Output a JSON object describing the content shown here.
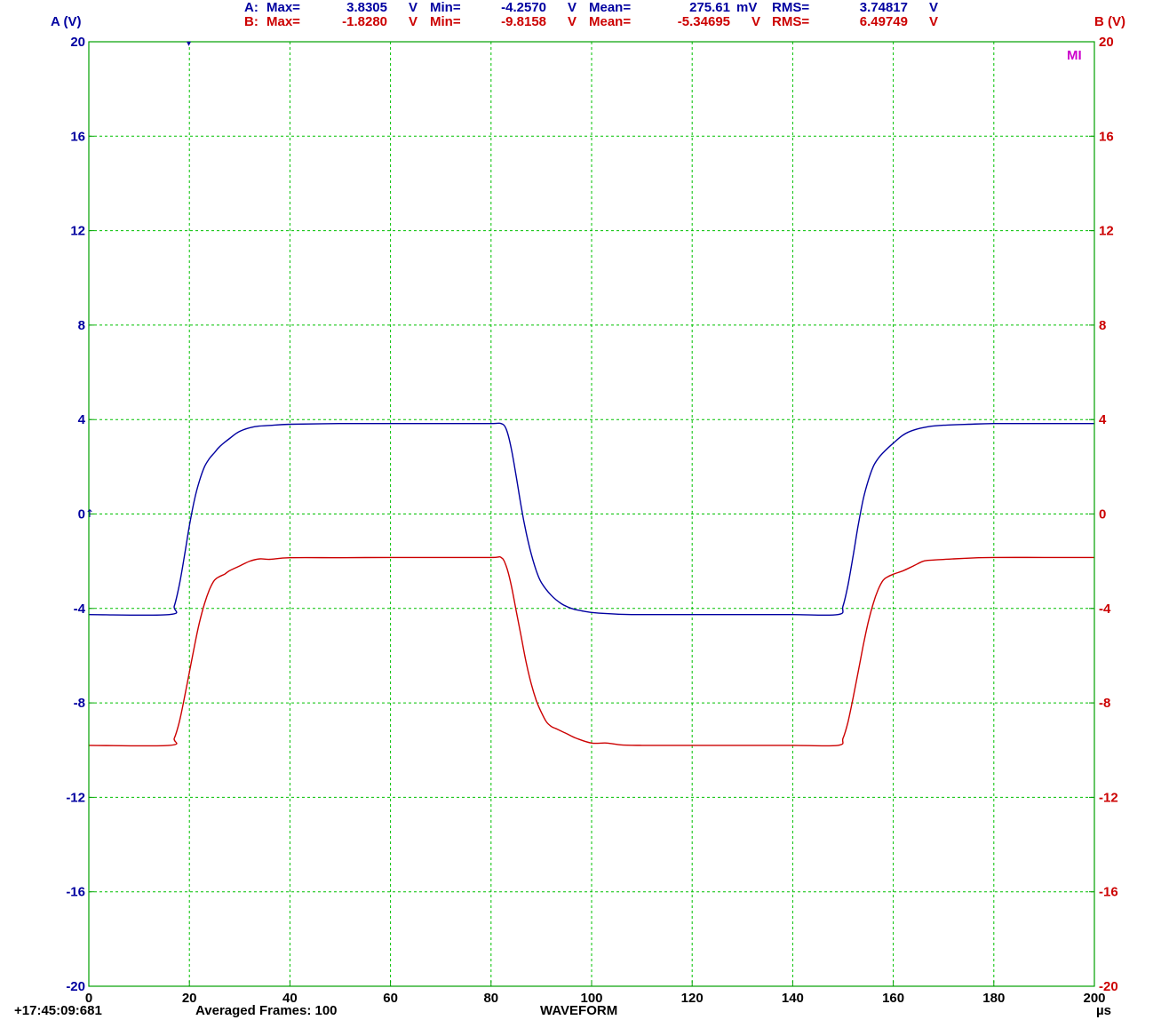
{
  "colors": {
    "channel_a": "#0000a0",
    "channel_b": "#cc0000",
    "grid": "#00c000",
    "frame": "#00a000",
    "math_label": "#cc00cc",
    "text": "#000000"
  },
  "stats": {
    "a": {
      "prefix": "A:",
      "max_label": "Max=",
      "max_value": "3.8305",
      "max_unit": "V",
      "min_label": "Min=",
      "min_value": "-4.2570",
      "min_unit": "V",
      "mean_label": "Mean=",
      "mean_value": "275.61",
      "mean_unit": "mV",
      "rms_label": "RMS=",
      "rms_value": "3.74817",
      "rms_unit": "V"
    },
    "b": {
      "prefix": "B:",
      "max_label": "Max=",
      "max_value": "-1.8280",
      "max_unit": "V",
      "min_label": "Min=",
      "min_value": "-9.8158",
      "min_unit": "V",
      "mean_label": "Mean=",
      "mean_value": "-5.34695",
      "mean_unit": "V",
      "rms_label": "RMS=",
      "rms_value": "6.49749",
      "rms_unit": "V"
    }
  },
  "footer": {
    "timestamp": "+17:45:09:681",
    "frames": "Averaged Frames: 100",
    "mode": "WAVEFORM",
    "x_unit": "µs"
  },
  "math_marker": "MI",
  "chart_data": {
    "type": "line",
    "y_left_label": "A (V)",
    "y_right_label": "B (V)",
    "xlim": [
      0,
      200
    ],
    "ylim": [
      -20,
      20
    ],
    "x_ticks": [
      "0",
      "20",
      "40",
      "60",
      "80",
      "100",
      "120",
      "140",
      "160",
      "180",
      "200"
    ],
    "y_ticks": [
      "20",
      "16",
      "12",
      "8",
      "4",
      "0",
      "-4",
      "-8",
      "-12",
      "-16",
      "-20"
    ],
    "grid": true,
    "series": [
      {
        "name": "A",
        "axis": "left",
        "x": [
          0,
          16,
          17,
          18,
          19,
          20,
          21,
          22,
          23,
          24,
          25,
          26,
          28,
          30,
          33,
          36,
          40,
          50,
          60,
          70,
          80,
          82,
          83,
          84,
          85,
          86,
          87,
          88,
          89,
          90,
          92,
          94,
          96,
          98,
          100,
          103,
          106,
          110,
          120,
          130,
          140,
          149,
          150,
          151,
          152,
          153,
          154,
          155,
          156,
          157,
          158,
          160,
          162,
          164,
          167,
          170,
          175,
          180,
          190,
          200
        ],
        "y": [
          -4.26,
          -4.26,
          -3.9,
          -3.0,
          -1.8,
          -0.5,
          0.6,
          1.4,
          2.0,
          2.35,
          2.6,
          2.85,
          3.2,
          3.5,
          3.7,
          3.75,
          3.8,
          3.83,
          3.83,
          3.83,
          3.83,
          3.83,
          3.6,
          2.8,
          1.6,
          0.3,
          -0.8,
          -1.7,
          -2.4,
          -2.9,
          -3.45,
          -3.8,
          -4.0,
          -4.1,
          -4.17,
          -4.22,
          -4.25,
          -4.26,
          -4.26,
          -4.26,
          -4.26,
          -4.26,
          -3.9,
          -3.0,
          -1.8,
          -0.5,
          0.6,
          1.4,
          2.0,
          2.35,
          2.6,
          3.0,
          3.35,
          3.55,
          3.7,
          3.76,
          3.8,
          3.83,
          3.83,
          3.83
        ]
      },
      {
        "name": "B",
        "axis": "right",
        "x": [
          0,
          16,
          17,
          18,
          19,
          20,
          21,
          22,
          23,
          24,
          25,
          26,
          27,
          28,
          30,
          32,
          34,
          36,
          40,
          50,
          60,
          70,
          80,
          82,
          83,
          84,
          85,
          86,
          87,
          88,
          89,
          90,
          91,
          92,
          93,
          95,
          97,
          100,
          103,
          106,
          110,
          120,
          130,
          140,
          149,
          150,
          151,
          152,
          153,
          154,
          155,
          156,
          157,
          158,
          159,
          160,
          162,
          164,
          166,
          168,
          172,
          176,
          180,
          190,
          200
        ],
        "y": [
          -9.8,
          -9.8,
          -9.5,
          -8.8,
          -7.8,
          -6.7,
          -5.6,
          -4.6,
          -3.8,
          -3.2,
          -2.8,
          -2.65,
          -2.55,
          -2.4,
          -2.2,
          -2.0,
          -1.9,
          -1.92,
          -1.85,
          -1.85,
          -1.84,
          -1.84,
          -1.84,
          -1.84,
          -2.2,
          -3.0,
          -4.1,
          -5.2,
          -6.3,
          -7.2,
          -7.9,
          -8.4,
          -8.8,
          -9.0,
          -9.1,
          -9.3,
          -9.5,
          -9.7,
          -9.7,
          -9.78,
          -9.8,
          -9.8,
          -9.8,
          -9.8,
          -9.8,
          -9.5,
          -8.8,
          -7.8,
          -6.7,
          -5.6,
          -4.6,
          -3.8,
          -3.2,
          -2.8,
          -2.65,
          -2.55,
          -2.4,
          -2.2,
          -2.0,
          -1.95,
          -1.9,
          -1.86,
          -1.84,
          -1.84,
          -1.84
        ]
      }
    ]
  }
}
